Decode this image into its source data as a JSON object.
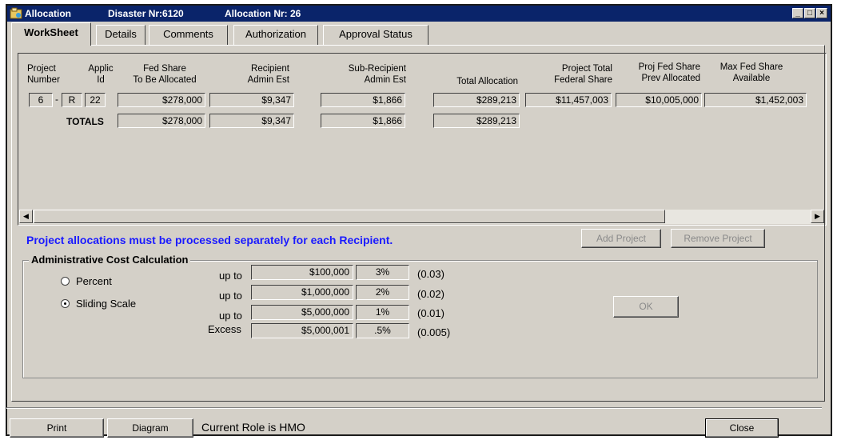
{
  "window": {
    "title_app": "Allocation",
    "title_disaster": "Disaster Nr:6120",
    "title_allocation": "Allocation Nr: 26"
  },
  "tabs": [
    {
      "label": "WorkSheet",
      "active": true
    },
    {
      "label": "Details"
    },
    {
      "label": "Comments"
    },
    {
      "label": "Authorization"
    },
    {
      "label": "Approval Status"
    }
  ],
  "grid": {
    "headers": {
      "project_number": [
        "Project",
        "Number"
      ],
      "applic_id": [
        "Applic",
        "Id"
      ],
      "fed_share": [
        "Fed Share",
        "To Be Allocated"
      ],
      "recipient_admin": [
        "Recipient",
        "Admin Est"
      ],
      "subrecipient_admin": [
        "Sub-Recipient",
        "Admin Est"
      ],
      "total_allocation": "Total Allocation",
      "project_total_fed": [
        "Project Total",
        "Federal Share"
      ],
      "proj_fed_prev": [
        "Proj Fed Share",
        "Prev Allocated"
      ],
      "max_fed_available": [
        "Max Fed Share",
        "Available"
      ]
    },
    "row": {
      "project_num": "6",
      "dash": "-",
      "project_type": "R",
      "applic_id": "22",
      "fed_share": "$278,000",
      "recipient_admin": "$9,347",
      "subrecipient_admin": "$1,866",
      "total_allocation": "$289,213",
      "project_total_fed": "$11,457,003",
      "proj_fed_prev": "$10,005,000",
      "max_fed_available": "$1,452,003"
    },
    "totals": {
      "label": "TOTALS",
      "fed_share": "$278,000",
      "recipient_admin": "$9,347",
      "subrecipient_admin": "$1,866",
      "total_allocation": "$289,213"
    }
  },
  "notice": "Project allocations must be processed separately for each Recipient.",
  "buttons": {
    "add_project": "Add Project",
    "remove_project": "Remove Project",
    "ok": "OK",
    "print": "Print",
    "diagram": "Diagram",
    "close": "Close"
  },
  "admin_calc": {
    "title": "Administrative Cost Calculation",
    "options": [
      {
        "label": "Percent",
        "selected": false
      },
      {
        "label": "Sliding Scale",
        "selected": true
      }
    ],
    "rows": [
      {
        "label": "up to",
        "amount": "$100,000",
        "pct": "3%",
        "decimal": "(0.03)"
      },
      {
        "label": "up to",
        "amount": "$1,000,000",
        "pct": "2%",
        "decimal": "(0.02)"
      },
      {
        "label": "up to",
        "amount": "$5,000,000",
        "pct": "1%",
        "decimal": "(0.01)"
      },
      {
        "label": "Excess",
        "amount": "$5,000,001",
        "pct": ".5%",
        "decimal": "(0.005)"
      }
    ]
  },
  "status": "Current Role is HMO",
  "colors": {
    "titlebar": "#0a246a",
    "notice": "#1a1aff",
    "face": "#d4d0c8"
  }
}
